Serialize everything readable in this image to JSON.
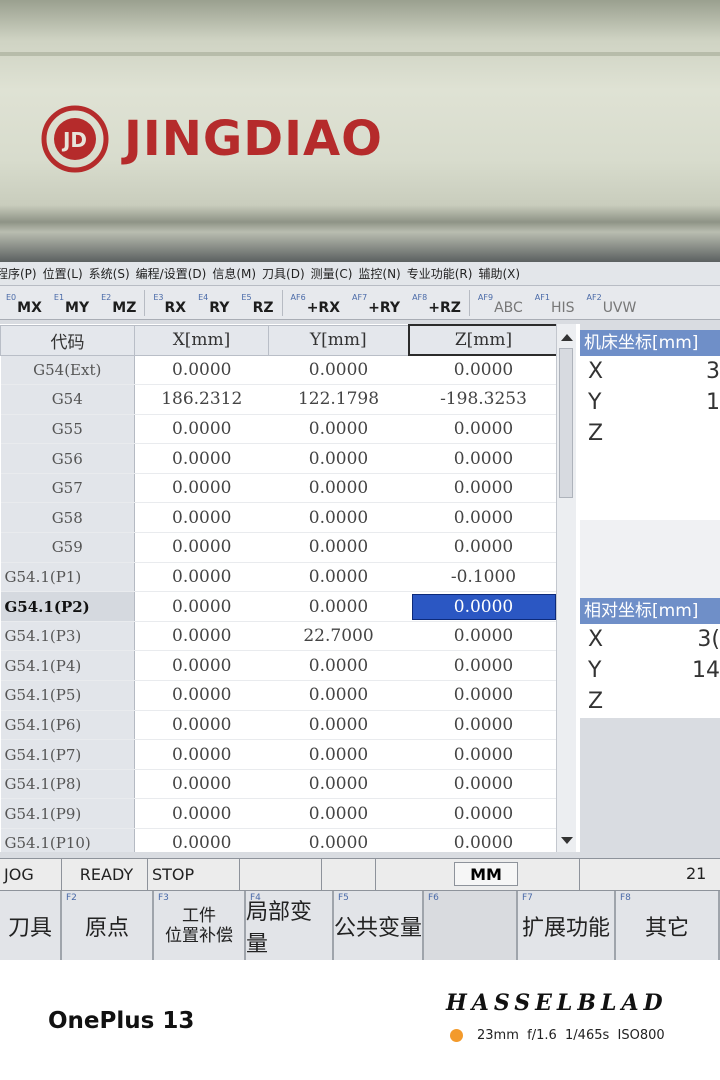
{
  "bezel": {
    "brand": "JINGDIAO",
    "logo_mark": "JD"
  },
  "menu": [
    "程序(P)",
    "位置(L)",
    "系统(S)",
    "编程/设置(D)",
    "信息(M)",
    "刀具(D)",
    "测量(C)",
    "监控(N)",
    "专业功能(R)",
    "辅助(X)"
  ],
  "funckeys": [
    {
      "key": "E0",
      "label": "MX"
    },
    {
      "key": "E1",
      "label": "MY"
    },
    {
      "key": "E2",
      "label": "MZ"
    },
    {
      "key": "E3",
      "label": "RX"
    },
    {
      "key": "E4",
      "label": "RY"
    },
    {
      "key": "E5",
      "label": "RZ"
    },
    {
      "key": "AF6",
      "label": "+RX"
    },
    {
      "key": "AF7",
      "label": "+RY"
    },
    {
      "key": "AF8",
      "label": "+RZ"
    },
    {
      "key": "AF9",
      "label": "ABC"
    },
    {
      "key": "AF1",
      "label": "HIS"
    },
    {
      "key": "AF2",
      "label": "UVW"
    }
  ],
  "table": {
    "headers": [
      "代码",
      "X[mm]",
      "Y[mm]",
      "Z[mm]"
    ],
    "rows": [
      {
        "code": "G54(Ext)",
        "x": "0.0000",
        "y": "0.0000",
        "z": "0.0000"
      },
      {
        "code": "G54",
        "x": "186.2312",
        "y": "122.1798",
        "z": "-198.3253"
      },
      {
        "code": "G55",
        "x": "0.0000",
        "y": "0.0000",
        "z": "0.0000"
      },
      {
        "code": "G56",
        "x": "0.0000",
        "y": "0.0000",
        "z": "0.0000"
      },
      {
        "code": "G57",
        "x": "0.0000",
        "y": "0.0000",
        "z": "0.0000"
      },
      {
        "code": "G58",
        "x": "0.0000",
        "y": "0.0000",
        "z": "0.0000"
      },
      {
        "code": "G59",
        "x": "0.0000",
        "y": "0.0000",
        "z": "0.0000"
      },
      {
        "code": "G54.1(P1)",
        "x": "0.0000",
        "y": "0.0000",
        "z": "-0.1000"
      },
      {
        "code": "G54.1(P2)",
        "x": "0.0000",
        "y": "0.0000",
        "z": "0.0000"
      },
      {
        "code": "G54.1(P3)",
        "x": "0.0000",
        "y": "22.7000",
        "z": "0.0000"
      },
      {
        "code": "G54.1(P4)",
        "x": "0.0000",
        "y": "0.0000",
        "z": "0.0000"
      },
      {
        "code": "G54.1(P5)",
        "x": "0.0000",
        "y": "0.0000",
        "z": "0.0000"
      },
      {
        "code": "G54.1(P6)",
        "x": "0.0000",
        "y": "0.0000",
        "z": "0.0000"
      },
      {
        "code": "G54.1(P7)",
        "x": "0.0000",
        "y": "0.0000",
        "z": "0.0000"
      },
      {
        "code": "G54.1(P8)",
        "x": "0.0000",
        "y": "0.0000",
        "z": "0.0000"
      },
      {
        "code": "G54.1(P9)",
        "x": "0.0000",
        "y": "0.0000",
        "z": "0.0000"
      },
      {
        "code": "G54.1(P10)",
        "x": "0.0000",
        "y": "0.0000",
        "z": "0.0000"
      }
    ]
  },
  "machine_coord": {
    "title": "机床坐标[mm]",
    "axes": [
      {
        "axis": "X",
        "value": "3"
      },
      {
        "axis": "Y",
        "value": "1"
      },
      {
        "axis": "Z",
        "value": ""
      }
    ]
  },
  "relative_coord": {
    "title": "相对坐标[mm]",
    "axes": [
      {
        "axis": "X",
        "value": "3("
      },
      {
        "axis": "Y",
        "value": "14"
      },
      {
        "axis": "Z",
        "value": ""
      }
    ]
  },
  "status": {
    "mode": "JOG",
    "state": "READY",
    "run": "STOP",
    "unit": "MM",
    "right_value": "21"
  },
  "softkeys": [
    {
      "key": "",
      "label": "刀具"
    },
    {
      "key": "F2",
      "label": "原点"
    },
    {
      "key": "F3",
      "label": "工件\n位置补偿"
    },
    {
      "key": "F4",
      "label": "局部变量"
    },
    {
      "key": "F5",
      "label": "公共变量"
    },
    {
      "key": "F6",
      "label": ""
    },
    {
      "key": "F7",
      "label": "扩展功能"
    },
    {
      "key": "F8",
      "label": "其它"
    }
  ],
  "footer": {
    "phone": "OnePlus 13",
    "brand": "HASSELBLAD",
    "specs": "23mm  f/1.6  1/465s  ISO800"
  }
}
